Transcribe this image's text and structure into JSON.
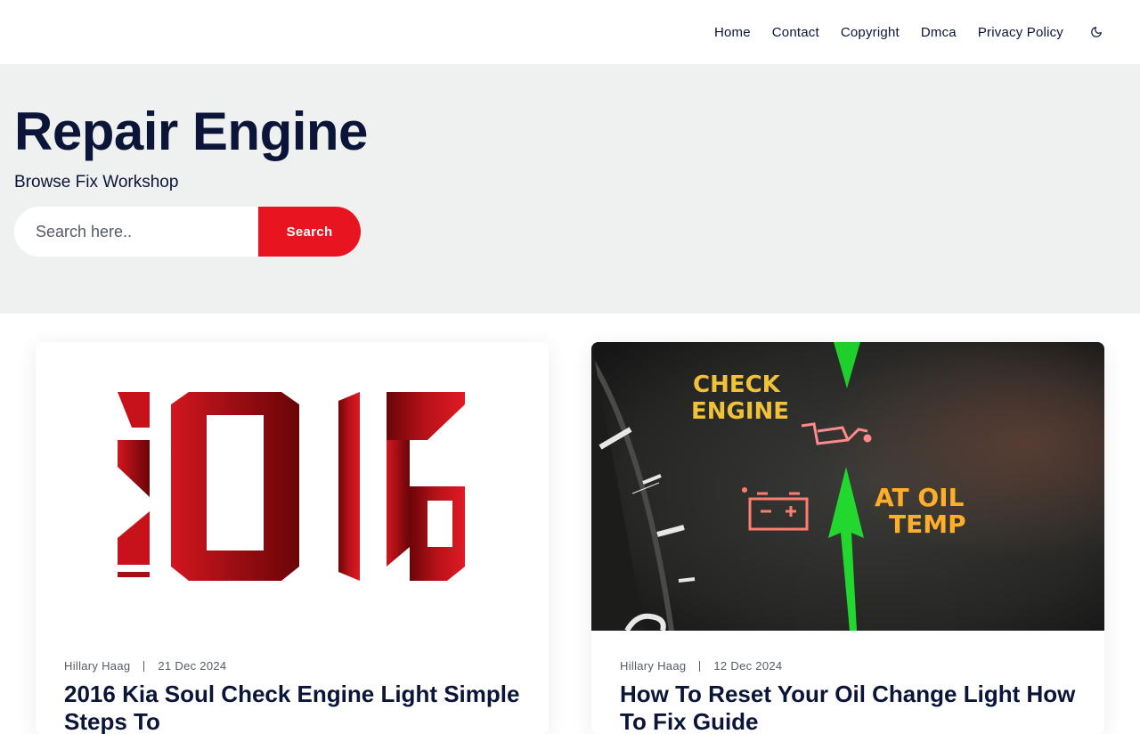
{
  "nav": {
    "items": [
      {
        "label": "Home"
      },
      {
        "label": "Contact"
      },
      {
        "label": "Copyright"
      },
      {
        "label": "Dmca"
      },
      {
        "label": "Privacy Policy"
      }
    ],
    "theme_toggle_icon": "moon-icon"
  },
  "hero": {
    "title": "Repair Engine",
    "tagline": "Browse Fix Workshop",
    "search": {
      "placeholder": "Search here..",
      "value": "",
      "button_label": "Search"
    }
  },
  "colors": {
    "accent": "#e8141f",
    "text": "#0b1538",
    "hero_bg": "#eff1f0"
  },
  "posts": [
    {
      "author": "Hillary Haag",
      "date": "21 Dec 2024",
      "title": "2016 Kia Soul Check Engine Light Simple Steps To",
      "image_text": "2016"
    },
    {
      "author": "Hillary Haag",
      "date": "12 Dec 2024",
      "title": "How To Reset Your Oil Change Light How To Fix Guide",
      "image_text": {
        "line1": "CHECK",
        "line2": "ENGINE",
        "line3": "AT OIL",
        "line4": "TEMP"
      }
    }
  ]
}
